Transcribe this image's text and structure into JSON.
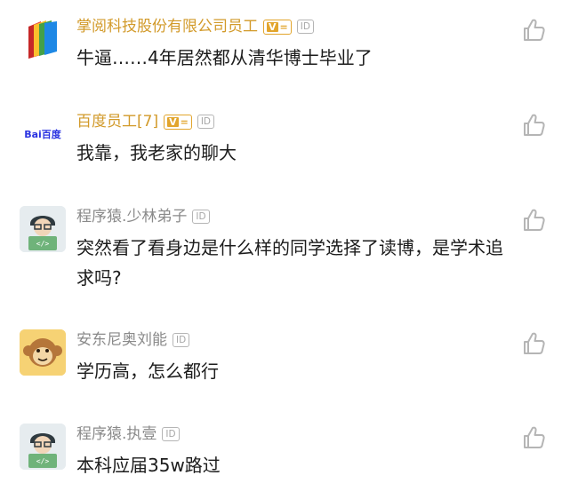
{
  "comments": [
    {
      "name": "掌阅科技股份有限公司员工",
      "verified": true,
      "text": "牛逼……4年居然都从清华博士毕业了",
      "avatar_icon": "book-stack-logo-icon"
    },
    {
      "name": "百度员工[7]",
      "verified": true,
      "text": "我靠，我老家的聊大",
      "avatar_icon": "baidu-logo-icon",
      "avatar_logo_text": "Bai百度"
    },
    {
      "name": "程序猿.少林弟子",
      "verified": false,
      "text": "突然看了看身边是什么样的同学选择了读博，是学术追求吗?",
      "avatar_icon": "coder-avatar-icon"
    },
    {
      "name": "安东尼奥刘能",
      "verified": false,
      "text": "学历高，怎么都行",
      "avatar_icon": "monkey-avatar-icon"
    },
    {
      "name": "程序猿.执壹",
      "verified": false,
      "text": "本科应届35w路过",
      "avatar_icon": "coder-avatar-icon"
    }
  ],
  "badges": {
    "id_label": "ID",
    "verified_label": "V"
  },
  "colors": {
    "official_name": "#d29a2a",
    "name": "#8a8a8a",
    "text": "#1c1c1c",
    "icon": "#b5b5b5",
    "verified": "#e2a52c"
  }
}
